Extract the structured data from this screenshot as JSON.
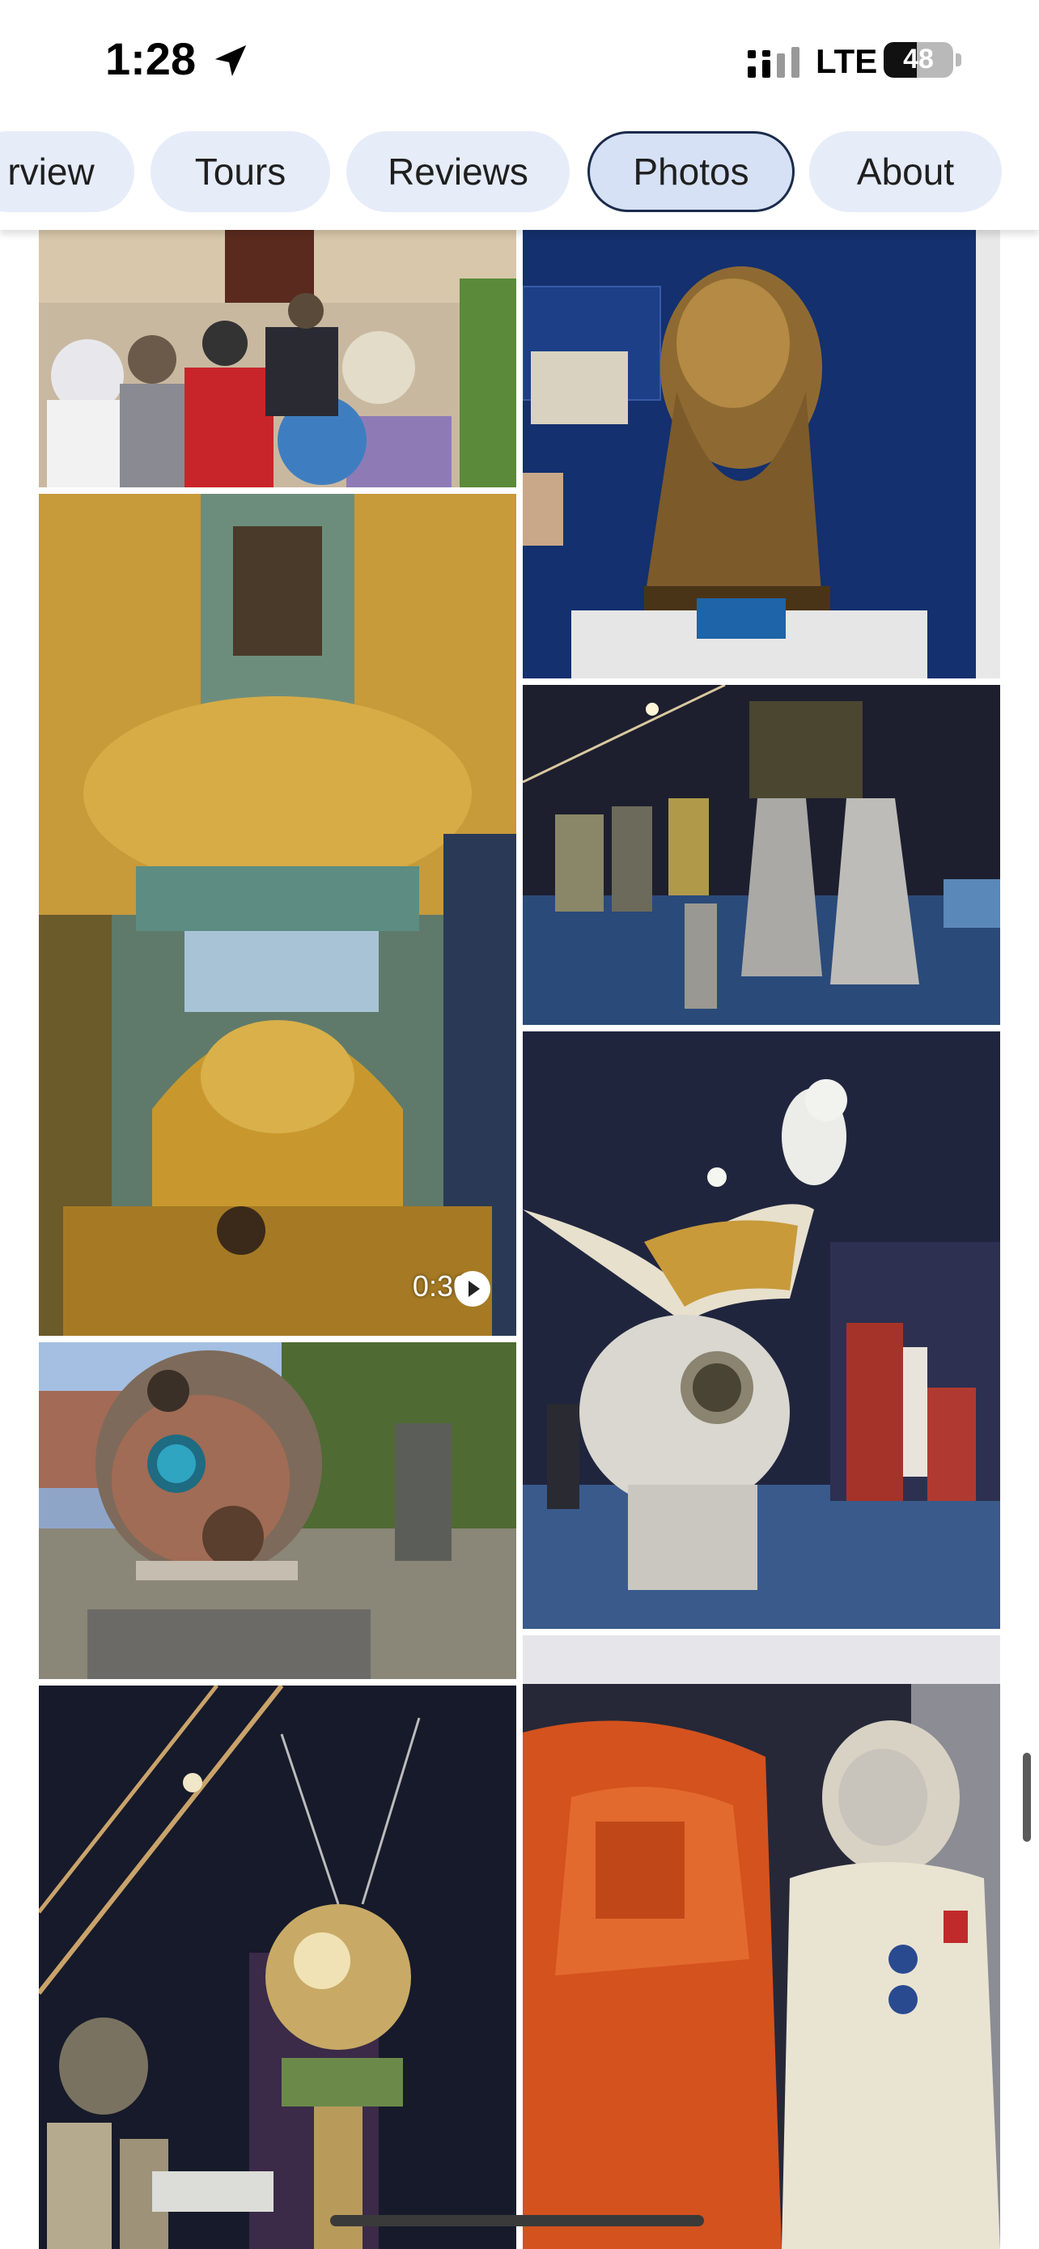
{
  "status_bar": {
    "time": "1:28",
    "network": "LTE",
    "battery": "48",
    "battery_level": 0.48
  },
  "tabs": [
    {
      "label": "rview"
    },
    {
      "label": "Tours"
    },
    {
      "label": "Reviews"
    },
    {
      "label": "Photos",
      "active": true
    },
    {
      "label": "About"
    }
  ],
  "photos": {
    "video_duration": "0:30"
  },
  "colors": {
    "tab_bg": "#e6ecf8",
    "tab_active_border": "#1b2b4a",
    "accent": "#1a73e8"
  }
}
